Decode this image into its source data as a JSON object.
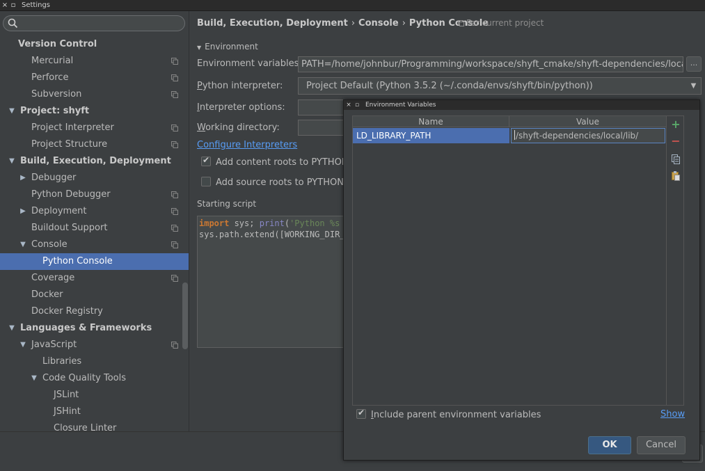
{
  "window": {
    "title": "Settings"
  },
  "sidebar": {
    "search_placeholder": "",
    "items": [
      {
        "label": "Version Control",
        "level": 0,
        "bold": true,
        "arrow": "",
        "icon": false
      },
      {
        "label": "Mercurial",
        "level": 1,
        "icon": true
      },
      {
        "label": "Perforce",
        "level": 1,
        "icon": true
      },
      {
        "label": "Subversion",
        "level": 1,
        "icon": true
      },
      {
        "label": "Project: shyft",
        "level": 0,
        "bold": true,
        "arrow": "▼",
        "icon": false
      },
      {
        "label": "Project Interpreter",
        "level": 1,
        "icon": true
      },
      {
        "label": "Project Structure",
        "level": 1,
        "icon": true
      },
      {
        "label": "Build, Execution, Deployment",
        "level": 0,
        "bold": true,
        "arrow": "▼",
        "icon": false
      },
      {
        "label": "Debugger",
        "level": 1,
        "arrow": "▶",
        "icon": false
      },
      {
        "label": "Python Debugger",
        "level": 1,
        "icon": true
      },
      {
        "label": "Deployment",
        "level": 1,
        "arrow": "▶",
        "icon": true
      },
      {
        "label": "Buildout Support",
        "level": 1,
        "icon": true
      },
      {
        "label": "Console",
        "level": 1,
        "arrow": "▼",
        "icon": true
      },
      {
        "label": "Python Console",
        "level": 2,
        "selected": true,
        "icon": false
      },
      {
        "label": "Coverage",
        "level": 1,
        "icon": true
      },
      {
        "label": "Docker",
        "level": 1,
        "icon": false
      },
      {
        "label": "Docker Registry",
        "level": 1,
        "icon": false
      },
      {
        "label": "Languages & Frameworks",
        "level": 0,
        "bold": true,
        "arrow": "▼",
        "icon": false
      },
      {
        "label": "JavaScript",
        "level": 1,
        "arrow": "▼",
        "icon": true
      },
      {
        "label": "Libraries",
        "level": 2,
        "icon": false
      },
      {
        "label": "Code Quality Tools",
        "level": 2,
        "arrow": "▼",
        "icon": false
      },
      {
        "label": "JSLint",
        "level": 3,
        "icon": false
      },
      {
        "label": "JSHint",
        "level": 3,
        "icon": false
      },
      {
        "label": "Closure Linter",
        "level": 3,
        "icon": false
      }
    ]
  },
  "main": {
    "breadcrumb": [
      "Build, Execution, Deployment",
      "Console",
      "Python Console"
    ],
    "for_project": "For current project",
    "environment_section": "Environment",
    "env_vars_label": "Environment variables:",
    "env_vars_value": "PATH=/home/johnbur/Programming/workspace/shyft_cmake/shyft-dependencies/local/lib/",
    "ellipsis": "...",
    "interpreter_label_u": "P",
    "interpreter_label_rest": "ython interpreter:",
    "interpreter_value": "Project Default (Python 3.5.2 (~/.conda/envs/shyft/bin/python))",
    "interp_options_label_u": "I",
    "interp_options_label_rest": "nterpreter options:",
    "working_dir_label_u": "W",
    "working_dir_label_rest": "orking directory:",
    "configure_link": "Configure Interpreters",
    "add_content_roots": "Add content roots to PYTHONF",
    "add_source_roots": "Add source roots to PYTHONPA",
    "starting_script_label": "Starting script",
    "script_line1": {
      "kw1": "import",
      "t1": " sys; ",
      "fn": "print",
      "t2": "(",
      "str": "'Python %s on %s'"
    },
    "script_line2": "sys.path.extend([WORKING_DIR_AN"
  },
  "dialog": {
    "title": "Environment Variables",
    "columns": [
      "Name",
      "Value"
    ],
    "rows": [
      {
        "name": "LD_LIBRARY_PATH",
        "value": "/shyft-dependencies/local/lib/"
      }
    ],
    "include_parent": "Include parent environment variables",
    "include_parent_u": "I",
    "include_parent_rest": "nclude parent environment variables",
    "show_link": "Show",
    "ok": "OK",
    "cancel": "Cancel"
  },
  "colors": {
    "selection": "#4b6eaf",
    "link": "#589df6",
    "add": "#59a869",
    "remove": "#c75450"
  }
}
